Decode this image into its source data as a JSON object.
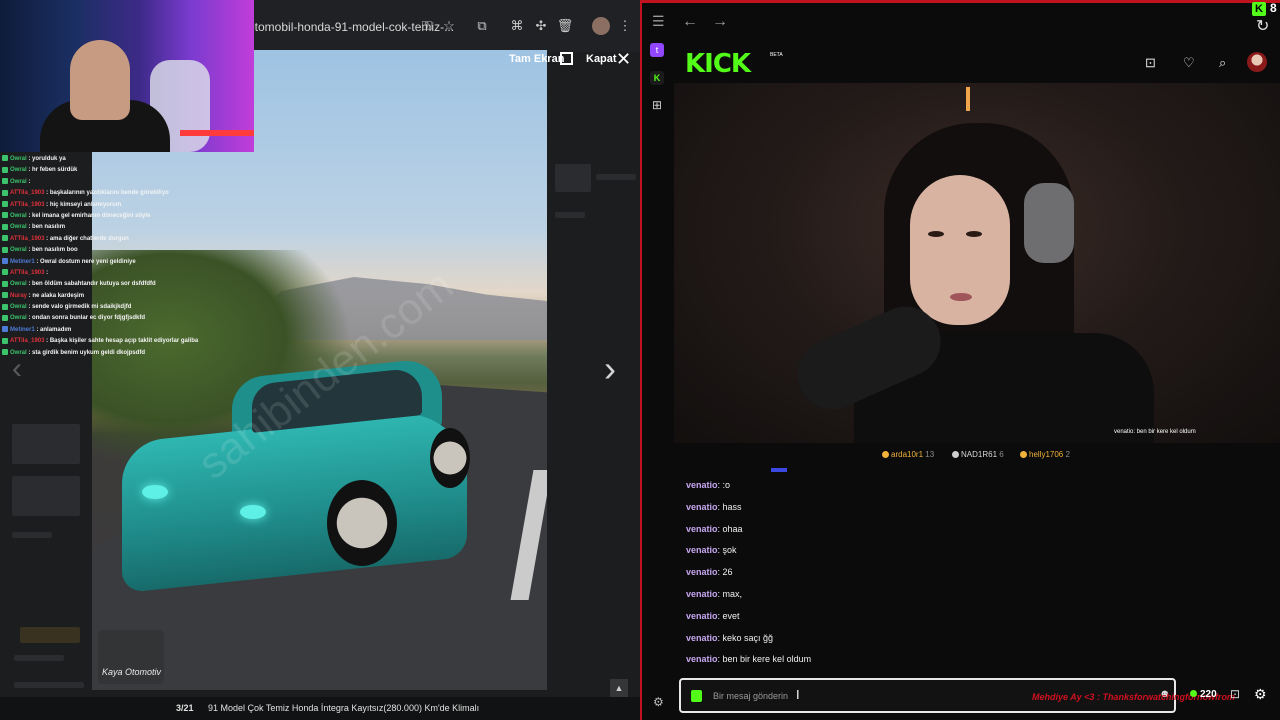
{
  "left_browser": {
    "url": "otomobil-honda-91-model-cok-temiz-...",
    "toolbar_icons": [
      "key-icon",
      "star-icon",
      "extension-icon",
      "translate-icon",
      "puzzle-icon",
      "trash-icon",
      "profile-icon",
      "more-icon"
    ]
  },
  "gallery": {
    "fullscreen_label": "Tam Ekran",
    "close_label": "Kapat",
    "counter": "3/21",
    "caption": "91 Model Çok Temiz Honda İntegra Kayıtsız(280.000) Km'de Klimalı",
    "logo_text": "Kaya Otomotiv",
    "watermark": "sahibinden.com"
  },
  "overlay_chat": [
    {
      "user": "Owral",
      "text": "yorulduk ya",
      "color": "#3bc46b"
    },
    {
      "user": "Owral",
      "text": "hr feben sürdük",
      "color": "#3bc46b"
    },
    {
      "user": "Owral",
      "text": "",
      "color": "#3bc46b"
    },
    {
      "user": "ATTila_1903",
      "text": "başkalarının yazdıklarını bende görebiliyo",
      "color": "#e0313b"
    },
    {
      "user": "ATTila_1903",
      "text": "hiç kimseyi anlamıyorum",
      "color": "#e0313b"
    },
    {
      "user": "Owral",
      "text": "kel imana gel emirhanın döneceğini söyle",
      "color": "#3bc46b"
    },
    {
      "user": "Owral",
      "text": "ben nasılım",
      "color": "#3bc46b"
    },
    {
      "user": "ATTila_1903",
      "text": "ama diğer chatlerde durgun",
      "color": "#e0313b"
    },
    {
      "user": "Owral",
      "text": "ben nasılım boo",
      "color": "#3bc46b"
    },
    {
      "user": "Metiner1",
      "text": "Owral dostum nere yeni geldiniye",
      "color": "#4d7bd6"
    },
    {
      "user": "ATTila_1903",
      "text": "",
      "color": "#e0313b"
    },
    {
      "user": "Owral",
      "text": "ben öldüm sabahtandır kutuya sor dsfdfdfd",
      "color": "#3bc46b"
    },
    {
      "user": "Nuray",
      "text": "ne alaka kardeşim",
      "color": "#e0313b"
    },
    {
      "user": "Owral",
      "text": "sende valo girmedik mi sdaikjkdjfd",
      "color": "#3bc46b"
    },
    {
      "user": "Owral",
      "text": "ondan sonra bunlar ec diyor fdjgfjsdkfd",
      "color": "#3bc46b"
    },
    {
      "user": "Metiner1",
      "text": "anlamadım",
      "color": "#4d7bd6"
    },
    {
      "user": "ATTila_1903",
      "text": "Başka kişiler sahte hesap açıp taklit ediyorlar galiba",
      "color": "#e0313b"
    },
    {
      "user": "Owral",
      "text": "sta girdik benim uykum geldi dkojpsdfd",
      "color": "#3bc46b"
    }
  ],
  "kick": {
    "logo": "KICK",
    "beta": "BETA",
    "notification_badge": "K",
    "notification_count": "8",
    "stream_overlay_msg": "venatio: ben bir kere kel oldum",
    "viewers": [
      {
        "name": "arda10r1",
        "count": "13",
        "color": "#f0b23a"
      },
      {
        "name": "NAD1R61",
        "count": "6",
        "color": "#cfcfcf"
      },
      {
        "name": "helly1706",
        "count": "2",
        "color": "#f0b23a"
      }
    ],
    "messages": [
      {
        "user": "venatio",
        "text": ":o"
      },
      {
        "user": "venatio",
        "text": "hass"
      },
      {
        "user": "venatio",
        "text": "ohaa"
      },
      {
        "user": "venatio",
        "text": "şok"
      },
      {
        "user": "venatio",
        "text": "26"
      },
      {
        "user": "venatio",
        "text": "max,"
      },
      {
        "user": "venatio",
        "text": "evet"
      },
      {
        "user": "venatio",
        "text": "keko saçı ğğ"
      },
      {
        "user": "venatio",
        "text": "ben bir kere kel oldum"
      }
    ],
    "input_placeholder": "Bir mesaj gönderin",
    "red_overlay_text": "Mehdiye Ay <3 : Thanksforwatchingfornowfrom",
    "points": "220",
    "accent_color": "#53fc18"
  }
}
